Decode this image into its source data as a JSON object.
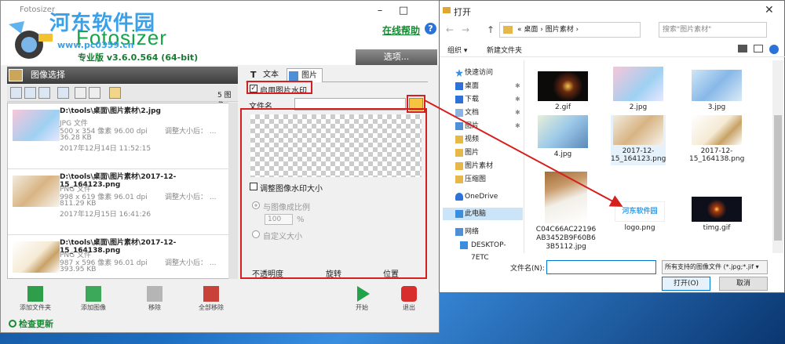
{
  "fotosizer": {
    "title": "Fotosizer",
    "watermark_text": "河东软件园",
    "brand": "Fotosizer",
    "watermark_url": "www.pc0359.cn",
    "version": "专业版   v3.6.0.564   (64-bit)",
    "help_link": "在线帮助",
    "help_icon": "?",
    "options_button": "选项...",
    "image_select_header": "图像选择",
    "image_count": "5 图像",
    "images": [
      {
        "name": "D:\\tools\\桌面\\图片素材\\2.jpg",
        "type": "JPG 文件",
        "dims": "500 x 354 像素 96.00 dpi",
        "size": "36.28 KB",
        "date": "2017年12月14日 11:52:15",
        "resize": "调整大小后：  ..."
      },
      {
        "name": "D:\\tools\\桌面\\图片素材\\2017-12-15_164123.png",
        "type": "PNG 文件",
        "dims": "998 x 619 像素 96.01 dpi",
        "size": "811.29 KB",
        "date": "2017年12月15日 16:41:26",
        "resize": "调整大小后：  ..."
      },
      {
        "name": "D:\\tools\\桌面\\图片素材\\2017-12-15_164138.png",
        "type": "PNG 文件",
        "dims": "987 x 596 像素 96.01 dpi",
        "size": "393.95 KB",
        "date": "",
        "resize": "调整大小后：  ..."
      }
    ],
    "tab_text": "文本",
    "tab_image": "图片",
    "enable_watermark": "启用图片水印",
    "file_name_label": "文件名",
    "resize_watermark": "调整图像水印大小",
    "scale_option": "与图像成比例",
    "scale_value": "100",
    "percent": "%",
    "custom_size": "自定义大小",
    "col_opacity": "不透明度",
    "col_rotation": "旋转",
    "col_position": "位置",
    "bottom_buttons": [
      "添加文件夹",
      "添加图像",
      "移除",
      "全部移除",
      "开始",
      "退出"
    ],
    "check_update": "检查更新",
    "colors": {
      "brand_green": "#16a34a",
      "annotation_red": "#d61f1f",
      "accent_blue": "#2d72d9"
    }
  },
  "dialog": {
    "title": "打开",
    "close": "✕",
    "nav_back": "←",
    "nav_forward": "→",
    "nav_up": "↑",
    "path": "«  桌面  ›  图片素材  ›",
    "search_placeholder": "搜索\"图片素材\"",
    "organize": "组织 ▾",
    "new_folder": "新建文件夹",
    "sidebar": [
      {
        "label": "快速访问"
      },
      {
        "label": "桌面"
      },
      {
        "label": "下载"
      },
      {
        "label": "文档"
      },
      {
        "label": "图片"
      },
      {
        "label": "视频"
      },
      {
        "label": "图片"
      },
      {
        "label": "图片素材"
      },
      {
        "label": "压缩图"
      },
      {
        "label": "OneDrive"
      },
      {
        "label": "此电脑"
      },
      {
        "label": "网络"
      },
      {
        "label": "DESKTOP-7ETC"
      }
    ],
    "files": [
      {
        "name": "2.gif"
      },
      {
        "name": "2.jpg"
      },
      {
        "name": "3.jpg"
      },
      {
        "name": "4.jpg"
      },
      {
        "name": "2017-12-15_164123.png"
      },
      {
        "name": "2017-12-15_164138.png"
      },
      {
        "name": "C04C66AC22196AB3452B9F60B63B5112.jpg"
      },
      {
        "name": "logo.png"
      },
      {
        "name": "timg.gif"
      }
    ],
    "filename_label": "文件名(N):",
    "filename_value": "",
    "filetype": "所有支持的图像文件 (*.jpg;*.jif ▾",
    "open_button": "打开(O)",
    "cancel_button": "取消"
  }
}
